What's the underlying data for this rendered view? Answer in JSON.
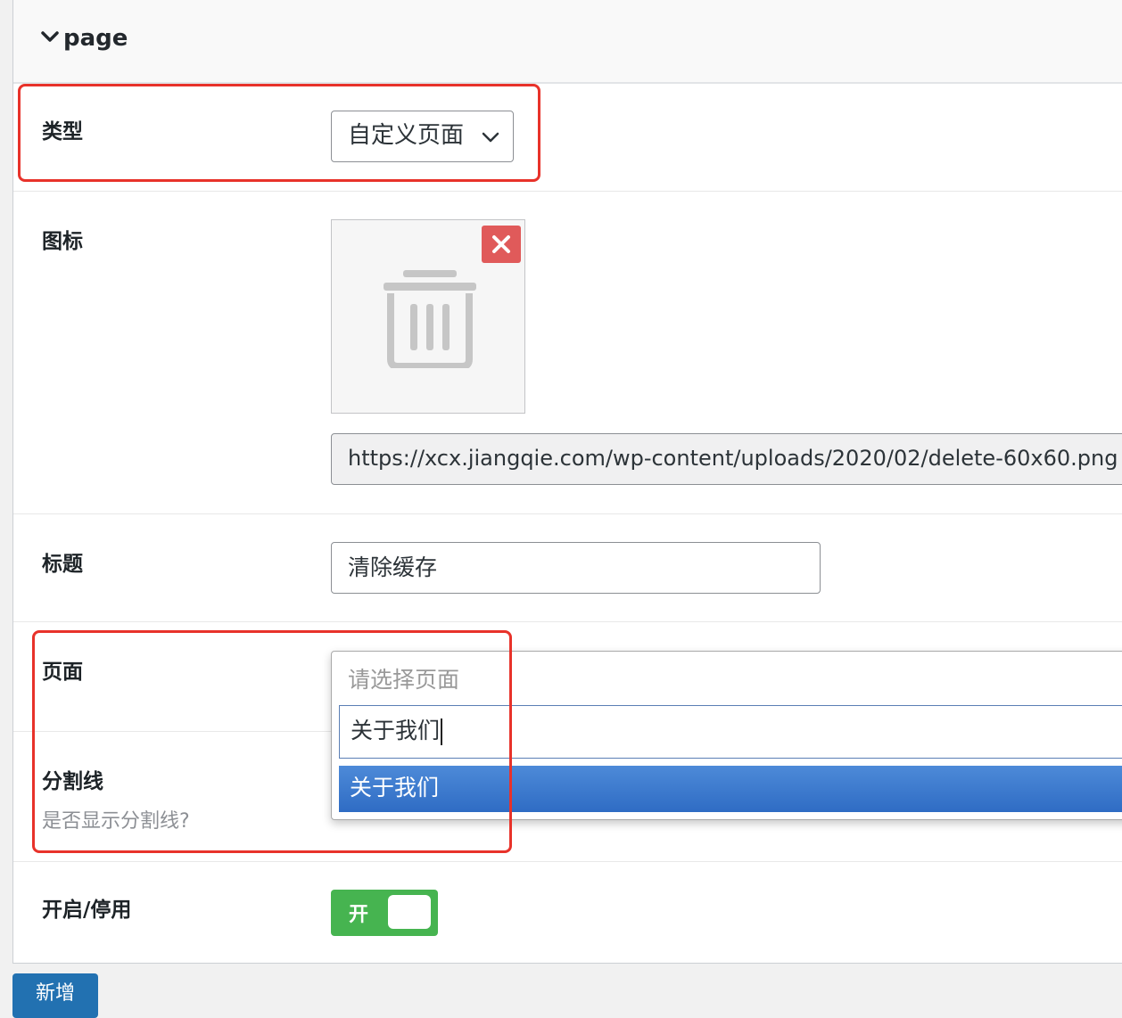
{
  "panel": {
    "title": "page"
  },
  "fields": {
    "type": {
      "label": "类型",
      "value": "自定义页面"
    },
    "icon": {
      "label": "图标",
      "url": "https://xcx.jiangqie.com/wp-content/uploads/2020/02/delete-60x60.png"
    },
    "title": {
      "label": "标题",
      "value": "清除缓存"
    },
    "page": {
      "label": "页面",
      "placeholder": "请选择页面",
      "search_value": "关于我们",
      "options": [
        "关于我们"
      ]
    },
    "divider": {
      "label": "分割线",
      "description": "是否显示分割线?"
    },
    "enable": {
      "label": "开启/停用",
      "toggle_label": "开"
    }
  },
  "actions": {
    "add_label": "新增"
  },
  "colors": {
    "highlight": "#e8322a",
    "toggle_on": "#46b450",
    "delete": "#e05a5a",
    "primary": "#2271b1",
    "option_selected": "#3b7bd0"
  }
}
